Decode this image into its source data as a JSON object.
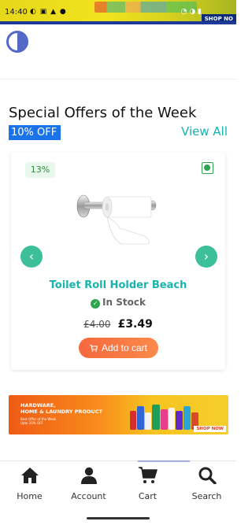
{
  "status_bar": {
    "time": "14:40",
    "shop_now_tag": "SHOP NO"
  },
  "section": {
    "title": "Special Offers of the Week",
    "badge": "10% OFF",
    "view_all": "View All"
  },
  "product": {
    "discount": "13%",
    "name": "Toilet Roll Holder Beach",
    "stock": "In Stock",
    "old_price": "£4.00",
    "new_price": "£3.49",
    "add_to_cart": "Add to cart",
    "prev_icon": "chevron-left-icon",
    "next_icon": "chevron-right-icon"
  },
  "banner": {
    "title": "HARDWARE,\nHOME & LAUNDRY PRODUCT",
    "subtitle": "Best Offer of the Week\nUpto 20% OFF",
    "shop_now": "SHOP NOW"
  },
  "tabs": [
    {
      "label": "Home",
      "icon": "home-icon"
    },
    {
      "label": "Account",
      "icon": "user-icon"
    },
    {
      "label": "Cart",
      "icon": "cart-icon"
    },
    {
      "label": "Search",
      "icon": "search-icon"
    }
  ],
  "colors": {
    "accent_teal": "#16b3b0",
    "badge_blue": "#1a73e8",
    "cta_orange": "#f7683e",
    "arrow_green": "#3dbf9a",
    "brand_indigo": "#5468c8"
  }
}
